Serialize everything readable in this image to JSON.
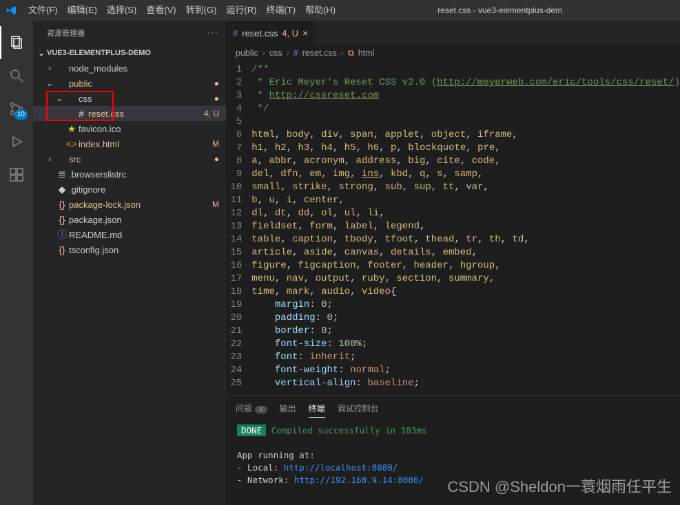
{
  "window": {
    "title": "reset.css - vue3-elementplus-dem"
  },
  "menu": [
    "文件(F)",
    "编辑(E)",
    "选择(S)",
    "查看(V)",
    "转到(G)",
    "运行(R)",
    "终端(T)",
    "帮助(H)"
  ],
  "activity": {
    "scm_badge": "10"
  },
  "sidebar": {
    "title": "资源管理器",
    "root": "VUE3-ELEMENTPLUS-DEMO",
    "items": [
      {
        "pad": 16,
        "chev": "›",
        "icon": "",
        "label": "node_modules",
        "cls": "",
        "status": "",
        "scls": ""
      },
      {
        "pad": 16,
        "chev": "⌄",
        "icon": "",
        "label": "public",
        "cls": "yellow",
        "status": "●",
        "scls": "yellow"
      },
      {
        "pad": 30,
        "chev": "⌄",
        "icon": "",
        "label": "css",
        "cls": "",
        "status": "●",
        "scls": "yellow"
      },
      {
        "pad": 44,
        "chev": "",
        "icon": "#",
        "label": "reset.css",
        "cls": "yellow",
        "status": "4, U",
        "scls": "yellow",
        "sel": true
      },
      {
        "pad": 30,
        "chev": "",
        "icon": "★",
        "label": "favicon.ico",
        "cls": "",
        "icls": "star",
        "status": "",
        "scls": ""
      },
      {
        "pad": 30,
        "chev": "",
        "icon": "<>",
        "label": "index.html",
        "cls": "yellow",
        "icls": "orange",
        "status": "M",
        "scls": "yellow"
      },
      {
        "pad": 16,
        "chev": "›",
        "icon": "",
        "label": "src",
        "cls": "yellow",
        "status": "●",
        "scls": "yellow"
      },
      {
        "pad": 16,
        "chev": "",
        "icon": "≣",
        "label": ".browserslistrc",
        "cls": "",
        "status": "",
        "scls": ""
      },
      {
        "pad": 16,
        "chev": "",
        "icon": "◆",
        "label": ".gitignore",
        "cls": "",
        "icls": "",
        "status": "",
        "scls": ""
      },
      {
        "pad": 16,
        "chev": "",
        "icon": "{}",
        "label": "package-lock.json",
        "cls": "yellow",
        "icls": "yellow",
        "status": "M",
        "scls": "yellow"
      },
      {
        "pad": 16,
        "chev": "",
        "icon": "{}",
        "label": "package.json",
        "cls": "",
        "icls": "yellow",
        "status": "",
        "scls": ""
      },
      {
        "pad": 16,
        "chev": "",
        "icon": "ⓘ",
        "label": "README.md",
        "cls": "",
        "icls": "blue",
        "status": "",
        "scls": ""
      },
      {
        "pad": 16,
        "chev": "",
        "icon": "{}",
        "label": "tsconfig.json",
        "cls": "",
        "icls": "yellow",
        "status": "",
        "scls": ""
      }
    ]
  },
  "tab": {
    "icon": "#",
    "name": "reset.css",
    "mod": "4, U"
  },
  "breadcrumb": [
    "public",
    "css",
    "reset.css",
    "html"
  ],
  "code": {
    "lines": [
      1,
      2,
      3,
      4,
      5,
      6,
      7,
      8,
      9,
      10,
      11,
      12,
      13,
      14,
      15,
      16,
      17,
      18,
      19,
      20,
      21,
      22,
      23,
      24,
      25
    ],
    "l1": "/**",
    "l2a": " * Eric Meyer's Reset CSS v2.0 (",
    "l2b": "http://meyerweb.com/eric/tools/css/reset/",
    "l2c": ")",
    "l3a": " * ",
    "l3b": "http://cssreset.com",
    "l4": " */",
    "l6": "html, body, div, span, applet, object, iframe,",
    "l7": "h1, h2, h3, h4, h5, h6, p, blockquote, pre,",
    "l8": "a, abbr, acronym, address, big, cite, code,",
    "l9a": "del, dfn, em, img, ",
    "l9b": "ins",
    "l9c": ", kbd, q, s, samp,",
    "l10": "small, strike, strong, sub, sup, tt, var,",
    "l11": "b, u, i, center,",
    "l12": "dl, dt, dd, ol, ul, li,",
    "l13": "fieldset, form, label, legend,",
    "l14": "table, caption, tbody, tfoot, thead, tr, th, td,",
    "l15": "article, aside, canvas, details, embed,",
    "l16": "figure, figcaption, footer, header, hgroup,",
    "l17": "menu, nav, output, ruby, section, summary,",
    "l18": "time, mark, audio, video{",
    "p19": "margin",
    "v19": "0",
    "p20": "padding",
    "v20": "0",
    "p21": "border",
    "v21": "0",
    "p22": "font-size",
    "v22": "100%",
    "p23": "font",
    "v23": "inherit",
    "p24": "font-weight",
    "v24": "normal",
    "p25": "vertical-align",
    "v25": "baseline"
  },
  "panel": {
    "tabs": {
      "problems": "问题",
      "pcount": "4",
      "output": "输出",
      "terminal": "终端",
      "debug": "调试控制台"
    },
    "done": "DONE",
    "compiled": "Compiled successfully in 103ms",
    "running": "App running at:",
    "local_lbl": "- Local:   ",
    "local_url": "http://localhost:8080/",
    "net_lbl": "- Network: ",
    "net_url": "http://192.168.9.14:8080/"
  },
  "watermark": "CSDN @Sheldon一蓑烟雨任平生"
}
